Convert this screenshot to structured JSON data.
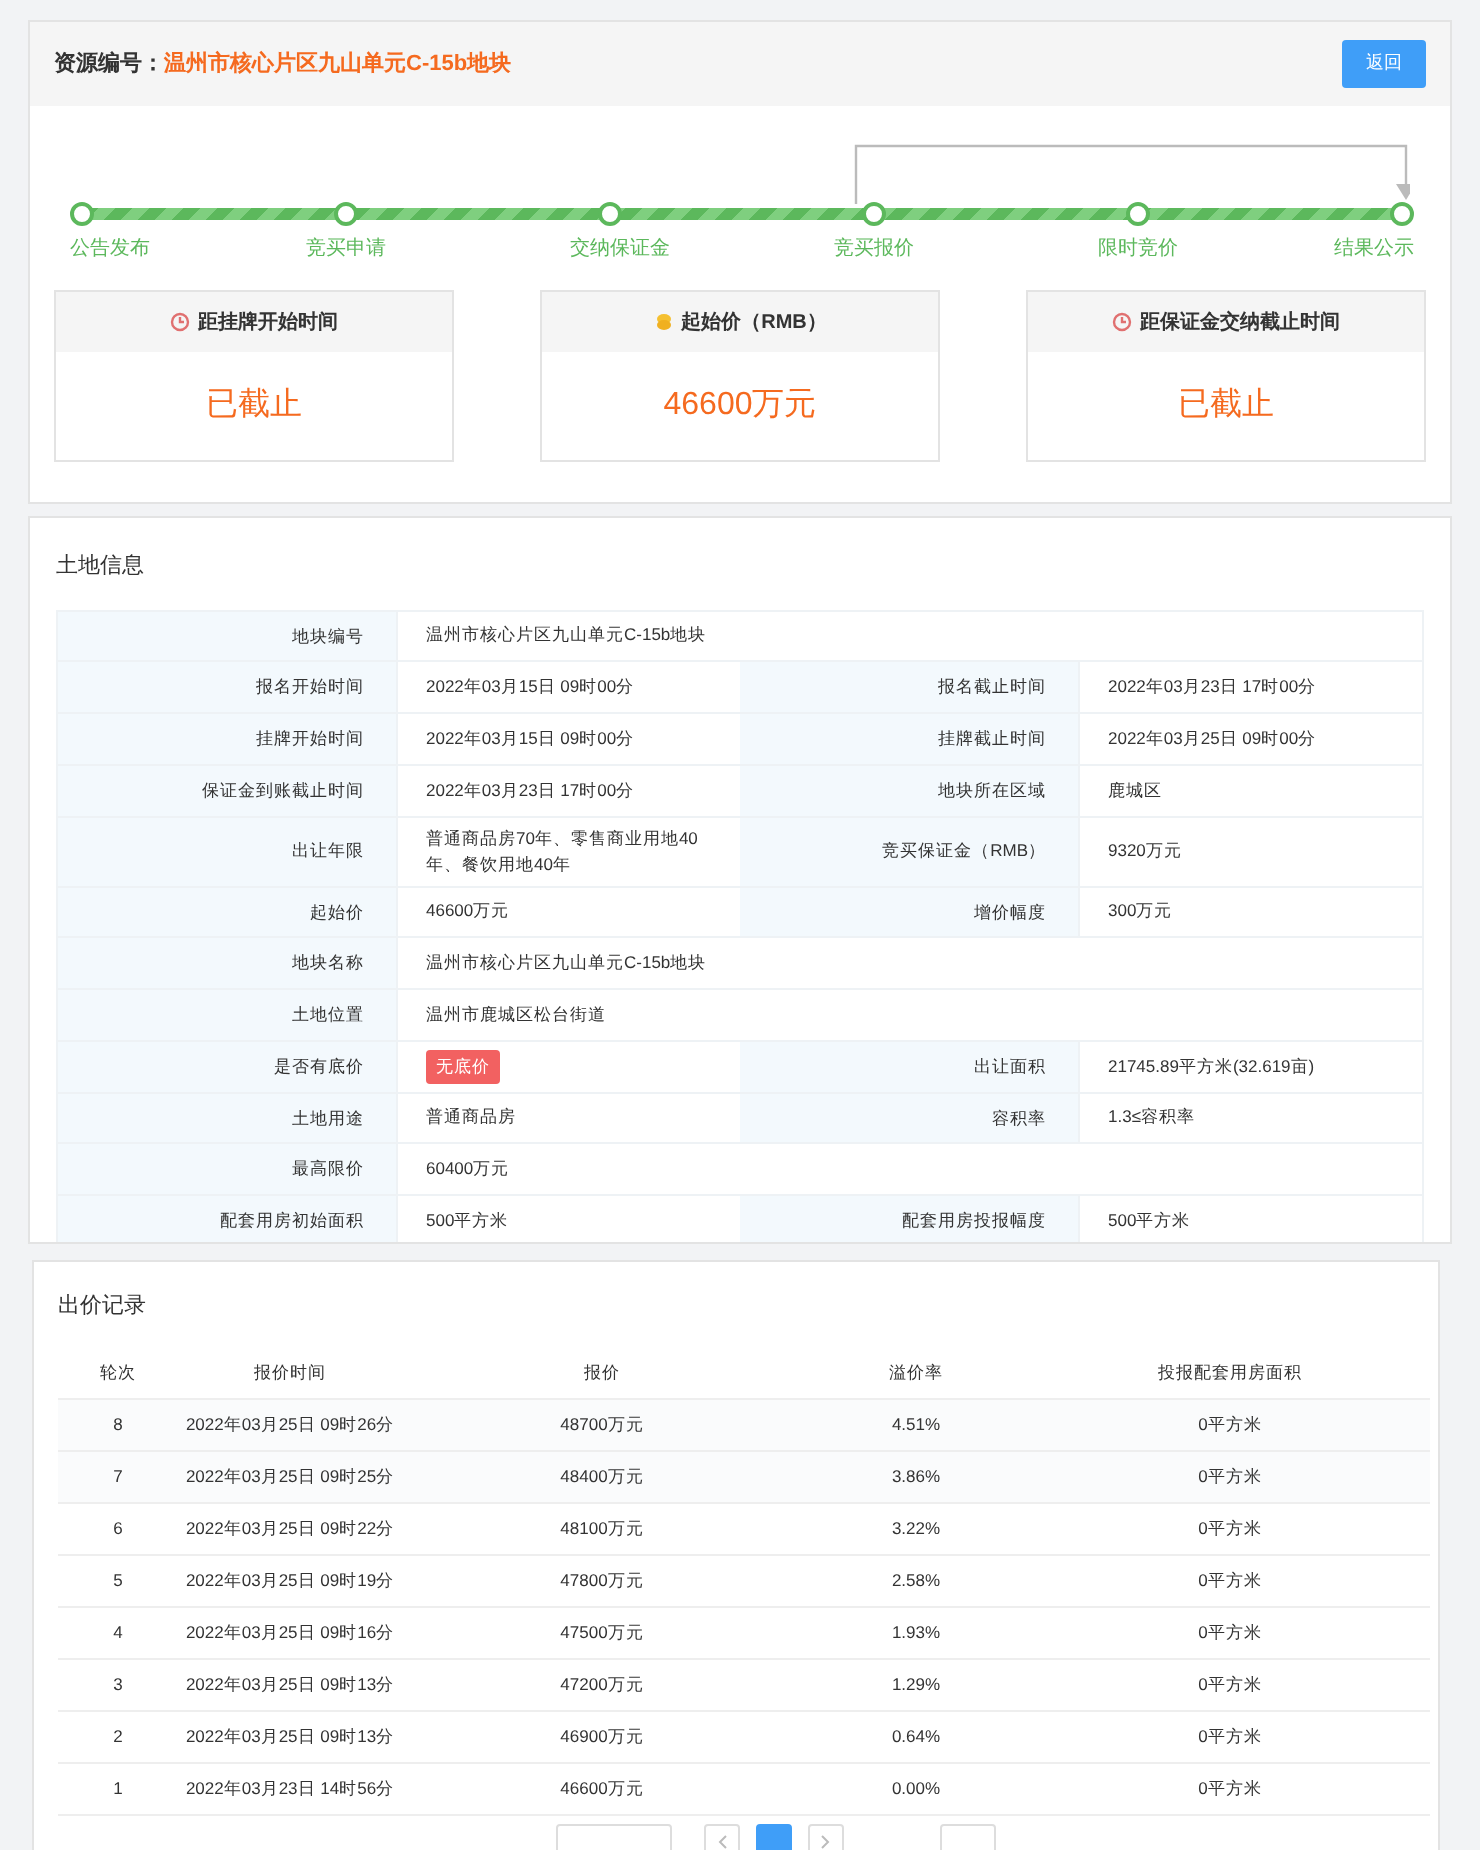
{
  "header": {
    "label": "资源编号：",
    "value": "温州市核心片区九山单元C-15b地块",
    "button": "返回"
  },
  "steps": [
    {
      "label": "公告发布",
      "done": true
    },
    {
      "label": "竞买申请",
      "done": true
    },
    {
      "label": "交纳保证金",
      "done": true
    },
    {
      "label": "竞买报价",
      "done": true
    },
    {
      "label": "限时竞价",
      "done": true
    },
    {
      "label": "结果公示",
      "done": true
    }
  ],
  "cards": [
    {
      "kind": "clock",
      "title": "距挂牌开始时间",
      "value": "已截止"
    },
    {
      "kind": "coin",
      "title": "起始价（RMB）",
      "value": "46600万元"
    },
    {
      "kind": "clock",
      "title": "距保证金交纳截止时间",
      "value": "已截止"
    }
  ],
  "land": {
    "title": "土地信息",
    "rows": [
      {
        "cells": [
          {
            "label": "地块编号",
            "value": "温州市核心片区九山单元C-15b地块",
            "kind": "text"
          }
        ]
      },
      {
        "cells": [
          {
            "label": "报名开始时间",
            "value": "2022年03月15日 09时00分",
            "kind": "text"
          },
          {
            "label": "报名截止时间",
            "value": "2022年03月23日 17时00分",
            "kind": "text"
          }
        ]
      },
      {
        "cells": [
          {
            "label": "挂牌开始时间",
            "value": "2022年03月15日 09时00分",
            "kind": "text"
          },
          {
            "label": "挂牌截止时间",
            "value": "2022年03月25日 09时00分",
            "kind": "text"
          }
        ]
      },
      {
        "cells": [
          {
            "label": "保证金到账截止时间",
            "value": "2022年03月23日 17时00分",
            "kind": "text"
          },
          {
            "label": "地块所在区域",
            "value": "鹿城区",
            "kind": "text"
          }
        ]
      },
      {
        "cells": [
          {
            "label": "出让年限",
            "value": "普通商品房70年、零售商业用地40年、餐饮用地40年",
            "kind": "text"
          },
          {
            "label": "竞买保证金（RMB）",
            "value": "9320万元",
            "kind": "text"
          }
        ]
      },
      {
        "cells": [
          {
            "label": "起始价",
            "value": "46600万元",
            "kind": "text"
          },
          {
            "label": "增价幅度",
            "value": "300万元",
            "kind": "text"
          }
        ]
      },
      {
        "cells": [
          {
            "label": "地块名称",
            "value": "温州市核心片区九山单元C-15b地块",
            "kind": "text"
          }
        ]
      },
      {
        "cells": [
          {
            "label": "土地位置",
            "value": "温州市鹿城区松台街道",
            "kind": "text"
          }
        ]
      },
      {
        "cells": [
          {
            "label": "是否有底价",
            "value": "无底价",
            "kind": "badge"
          },
          {
            "label": "出让面积",
            "value": "21745.89平方米(32.619亩)",
            "kind": "text"
          }
        ]
      },
      {
        "cells": [
          {
            "label": "土地用途",
            "value": "普通商品房",
            "kind": "text"
          },
          {
            "label": "容积率",
            "value": "1.3≤容积率",
            "kind": "text"
          }
        ]
      },
      {
        "cells": [
          {
            "label": "最高限价",
            "value": "60400万元",
            "kind": "text"
          },
          {
            "kind": "empty"
          }
        ]
      },
      {
        "cells": [
          {
            "label": "配套用房初始面积",
            "value": "500平方米",
            "kind": "text"
          },
          {
            "label": "配套用房投报幅度",
            "value": "500平方米",
            "kind": "text"
          }
        ]
      }
    ]
  },
  "bids": {
    "title": "出价记录",
    "columns": [
      "轮次",
      "报价时间",
      "报价",
      "溢价率",
      "投报配套用房面积"
    ],
    "rows": [
      [
        "8",
        "2022年03月25日 09时26分",
        "48700万元",
        "4.51%",
        "0平方米"
      ],
      [
        "7",
        "2022年03月25日 09时25分",
        "48400万元",
        "3.86%",
        "0平方米"
      ],
      [
        "6",
        "2022年03月25日 09时22分",
        "48100万元",
        "3.22%",
        "0平方米"
      ],
      [
        "5",
        "2022年03月25日 09时19分",
        "47800万元",
        "2.58%",
        "0平方米"
      ],
      [
        "4",
        "2022年03月25日 09时16分",
        "47500万元",
        "1.93%",
        "0平方米"
      ],
      [
        "3",
        "2022年03月25日 09时13分",
        "47200万元",
        "1.29%",
        "0平方米"
      ],
      [
        "2",
        "2022年03月25日 09时13分",
        "46900万元",
        "0.64%",
        "0平方米"
      ],
      [
        "1",
        "2022年03月23日 14时56分",
        "46600万元",
        "0.00%",
        "0平方米"
      ]
    ],
    "pagination": [
      {
        "kind": "prev",
        "selected": false
      },
      {
        "kind": "page",
        "selected": true
      },
      {
        "kind": "next",
        "selected": false
      }
    ]
  }
}
